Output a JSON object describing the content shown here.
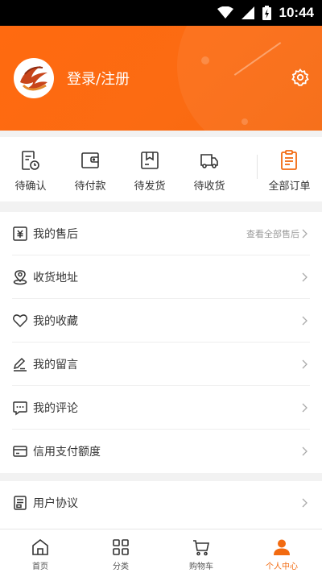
{
  "status_bar": {
    "time": "10:44"
  },
  "header": {
    "login_label": "登录/注册"
  },
  "orders": [
    {
      "label": "待确认"
    },
    {
      "label": "待付款"
    },
    {
      "label": "待发货"
    },
    {
      "label": "待收货"
    },
    {
      "label": "全部订单"
    }
  ],
  "menu": {
    "after_sales": {
      "label": "我的售后",
      "hint": "查看全部售后"
    },
    "address": {
      "label": "收货地址"
    },
    "favorites": {
      "label": "我的收藏"
    },
    "messages": {
      "label": "我的留言"
    },
    "reviews": {
      "label": "我的评论"
    },
    "credit": {
      "label": "信用支付额度"
    },
    "agreement": {
      "label": "用户协议"
    }
  },
  "tabbar": [
    {
      "label": "首页"
    },
    {
      "label": "分类"
    },
    {
      "label": "购物车"
    },
    {
      "label": "个人中心"
    }
  ],
  "colors": {
    "accent": "#f26a10",
    "header_bg": "#fb6b12"
  }
}
